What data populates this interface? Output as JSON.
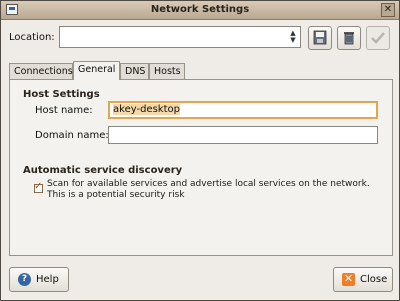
{
  "window": {
    "title": "Network Settings"
  },
  "toolbar": {
    "location_label": "Location:",
    "location_value": ""
  },
  "tabs": [
    {
      "label": "Connections"
    },
    {
      "label": "General"
    },
    {
      "label": "DNS"
    },
    {
      "label": "Hosts"
    }
  ],
  "host_settings": {
    "heading": "Host Settings",
    "host_name_label": "Host name:",
    "host_name_value": "akey-desktop",
    "domain_name_label": "Domain name:",
    "domain_name_value": ""
  },
  "discovery": {
    "heading": "Automatic service discovery",
    "checkbox_text": "Scan for available services and advertise local services on the network. This is a potential security risk",
    "checked": true
  },
  "buttons": {
    "help_label": "Help",
    "close_label": "Close"
  },
  "icons": {
    "window": "network-icon",
    "help": "help-icon",
    "close": "close-icon",
    "save": "floppy-save-icon",
    "delete": "delete-location-icon",
    "apply": "checkmark-icon"
  },
  "colors": {
    "focus_border": "#e6a451",
    "title_bar": "#c9b9a3"
  }
}
